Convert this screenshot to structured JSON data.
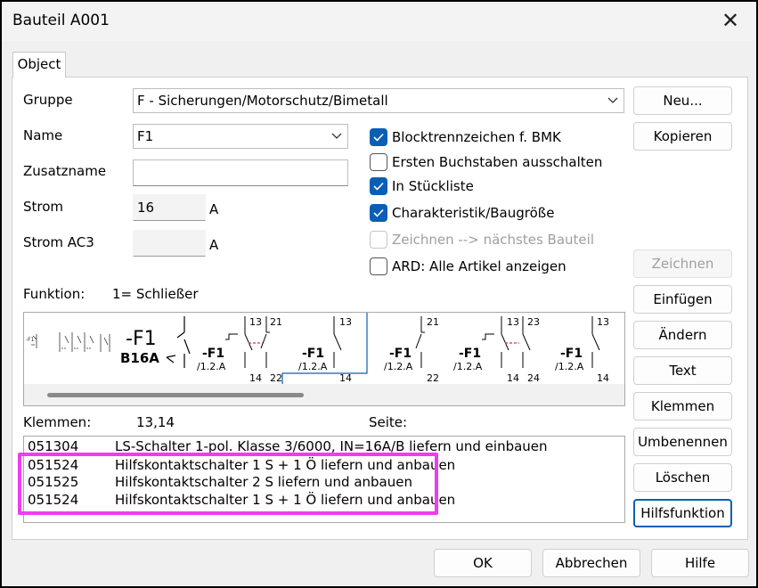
{
  "window": {
    "title": "Bauteil A001"
  },
  "tabs": [
    {
      "label": "Object"
    }
  ],
  "fields": {
    "gruppe": {
      "label": "Gruppe",
      "value": "F - Sicherungen/Motorschutz/Bimetall"
    },
    "name": {
      "label": "Name",
      "value": "F1"
    },
    "zusatzname": {
      "label": "Zusatzname",
      "value": ""
    },
    "strom": {
      "label": "Strom",
      "value": "16",
      "unit": "A"
    },
    "strom_ac3": {
      "label": "Strom AC3",
      "value": "",
      "unit": "A"
    }
  },
  "checkboxes": [
    {
      "label": "Blocktrennzeichen f. BMK",
      "state": "checked"
    },
    {
      "label": "Ersten Buchstaben ausschalten",
      "state": "unchecked"
    },
    {
      "label": "In Stückliste",
      "state": "checked"
    },
    {
      "label": "Charakteristik/Baugröße",
      "state": "checked"
    },
    {
      "label": "Zeichnen --> nächstes Bauteil",
      "state": "disabled"
    },
    {
      "label": "ARD: Alle Artikel anzeigen",
      "state": "unchecked"
    }
  ],
  "funktion": {
    "label": "Funktion:",
    "value": "1= Schließer"
  },
  "symbols": {
    "main": {
      "name": "-F1",
      "type": "B16A"
    },
    "items": [
      {
        "name": "-F1",
        "ref": "/1.2.A",
        "top": [
          "13",
          "21"
        ],
        "bottom": [
          "14",
          "22"
        ]
      },
      {
        "name": "-F1",
        "ref": "/1.2.A",
        "top": [
          "13"
        ],
        "bottom": [
          "14"
        ]
      },
      {
        "name": "-F1",
        "ref": "/1.2.A",
        "top": [
          "21"
        ],
        "bottom": [
          "22"
        ]
      },
      {
        "name": "-F1",
        "ref": "/1.2.A",
        "top": [
          "13",
          "23"
        ],
        "bottom": [
          "14",
          "24"
        ]
      },
      {
        "name": "-F1",
        "ref": "/1.2.A",
        "top": [
          "13"
        ],
        "bottom": [
          "14"
        ]
      }
    ]
  },
  "klemmen": {
    "label": "Klemmen:",
    "value": "13,14"
  },
  "seite": {
    "label": "Seite:"
  },
  "articles": [
    {
      "code": "051304",
      "desc": "LS-Schalter 1-pol. Klasse 3/6000, IN=16A/B liefern und einbauen"
    },
    {
      "code": "051524",
      "desc": "Hilfskontaktschalter 1 S + 1 Ö liefern und anbauen"
    },
    {
      "code": "051525",
      "desc": "Hilfskontaktschalter 2 S liefern und anbauen"
    },
    {
      "code": "051524",
      "desc": "Hilfskontaktschalter 1 S + 1 Ö liefern und anbauen"
    }
  ],
  "side_buttons": {
    "neu": "Neu...",
    "kopieren": "Kopieren",
    "zeichnen": "Zeichnen",
    "einfuegen": "Einfügen",
    "aendern": "Ändern",
    "text": "Text",
    "klemmen": "Klemmen",
    "umbenennen": "Umbenennen",
    "loeschen": "Löschen",
    "hilfsfunktion": "Hilfsfunktion"
  },
  "footer_buttons": {
    "ok": "OK",
    "abbrechen": "Abbrechen",
    "hilfe": "Hilfe"
  },
  "colors": {
    "accent": "#0a5fb4",
    "highlight": "#f03cf0",
    "dashed_link": "#e03030"
  },
  "icons": {
    "close": "close-icon",
    "dropdown": "chevron-down-icon",
    "check": "checkmark-icon"
  }
}
